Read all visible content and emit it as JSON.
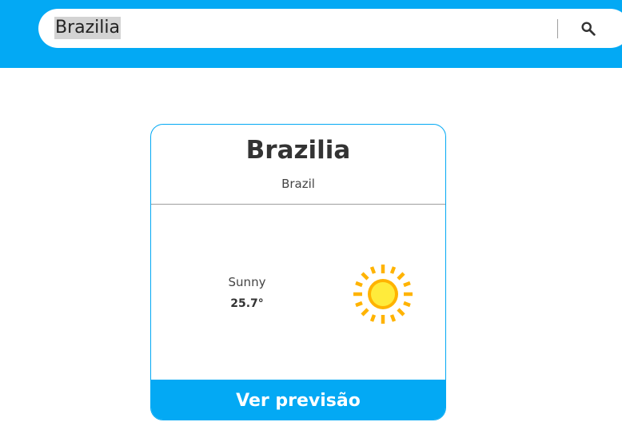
{
  "search": {
    "value": "Brazilia",
    "icon": "search-icon"
  },
  "card": {
    "city": "Brazilia",
    "country": "Brazil",
    "condition": "Sunny",
    "temperature": "25.7°",
    "weather_icon": "sun-icon",
    "forecast_button_label": "Ver previsão"
  },
  "colors": {
    "accent": "#03a9f4",
    "sun_core": "#ffeb3b",
    "sun_ray": "#ffb300"
  }
}
